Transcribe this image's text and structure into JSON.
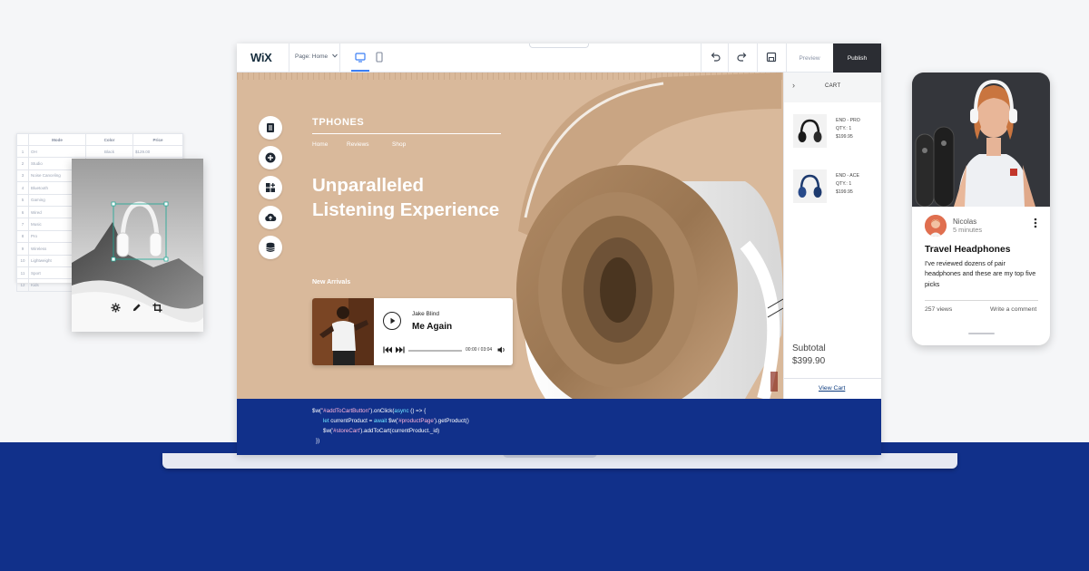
{
  "spreadsheet": {
    "headers": [
      "Mode",
      "Color",
      "Price"
    ],
    "rows": [
      {
        "num": "1",
        "mode": "OH",
        "color": "Black",
        "price": "$129.00"
      },
      {
        "num": "2",
        "mode": "Studio",
        "color": "",
        "price": ""
      },
      {
        "num": "3",
        "mode": "Noise Canceling",
        "color": "",
        "price": ""
      },
      {
        "num": "4",
        "mode": "Bluetooth",
        "color": "",
        "price": ""
      },
      {
        "num": "5",
        "mode": "Gaming",
        "color": "",
        "price": ""
      },
      {
        "num": "6",
        "mode": "Wired",
        "color": "",
        "price": ""
      },
      {
        "num": "7",
        "mode": "Music",
        "color": "",
        "price": ""
      },
      {
        "num": "8",
        "mode": "Pro",
        "color": "",
        "price": ""
      },
      {
        "num": "9",
        "mode": "Wireless",
        "color": "",
        "price": ""
      },
      {
        "num": "10",
        "mode": "Lightweight",
        "color": "",
        "price": ""
      },
      {
        "num": "11",
        "mode": "Sport",
        "color": "",
        "price": ""
      },
      {
        "num": "12",
        "mode": "Kids",
        "color": "",
        "price": ""
      }
    ]
  },
  "editor": {
    "logo": "WiX",
    "page_select": "Page: Home",
    "preview_label": "Preview",
    "publish_label": "Publish",
    "icons": [
      "desktop-icon",
      "mobile-icon",
      "undo-icon",
      "redo-icon",
      "save-icon"
    ]
  },
  "site": {
    "name": "TPHONES",
    "nav": [
      "Home",
      "Reviews",
      "Shop"
    ],
    "hero_line1": "Unparalleled",
    "hero_line2": "Listening Experience",
    "arrivals_label": "New Arrivals",
    "side_tools": [
      "pages-icon",
      "add-icon",
      "apps-icon",
      "upload-icon",
      "database-icon"
    ]
  },
  "player": {
    "artist": "Jake Blind",
    "track": "Me Again",
    "time": "00:00 / 03:04",
    "progress": 0
  },
  "cart": {
    "title": "CART",
    "items": [
      {
        "name": "END - PRO",
        "qty": "QTY.: 1",
        "price": "$199.95"
      },
      {
        "name": "END - ACE",
        "qty": "QTY.: 1",
        "price": "$199.95"
      }
    ],
    "subtotal_label": "Subtotal",
    "subtotal_value": "$399.90",
    "view_cart": "View Cart"
  },
  "code": {
    "line1_a": "$w(",
    "line1_str": "\"#addToCartButton\"",
    "line1_b": ").onClick(",
    "line1_kw": "async",
    "line1_c": " () => {",
    "line2_kw": "let",
    "line2_a": " currentProduct = ",
    "line2_kw2": "await",
    "line2_b": " $w(",
    "line2_str": "'#productPage'",
    "line2_c": ").getProduct()",
    "line3_a": "$w(",
    "line3_str": "'#storeCart'",
    "line3_b": ").addToCart(currentProduct._id)",
    "line4": "})"
  },
  "phone": {
    "author": "Nicolas",
    "time_ago": "5 minutes",
    "post_title": "Travel Headphones",
    "post_body": "I've reviewed dozens of pair headphones and these are my top five picks",
    "views": "257 views",
    "write_comment": "Write a comment"
  },
  "colors": {
    "band_blue": "#11308a",
    "canvas_tan": "#d9b99b",
    "publish_bg": "#2b2d33",
    "accent_blue": "#3b7ff5"
  }
}
